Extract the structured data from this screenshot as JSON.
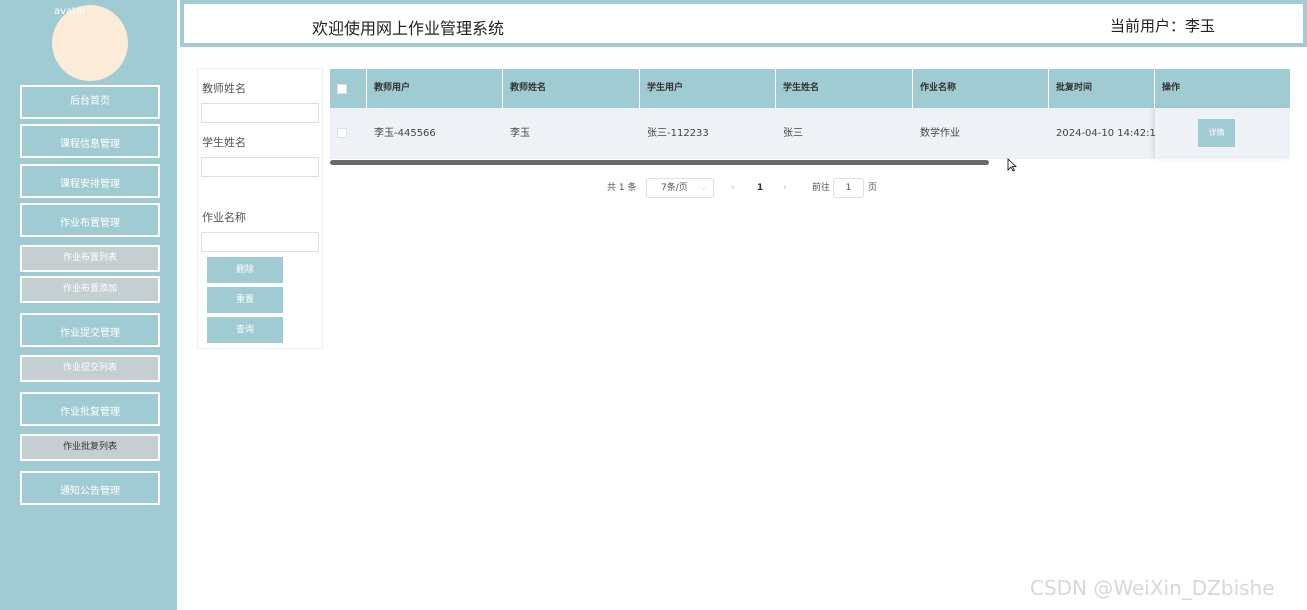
{
  "sidebar": {
    "avatar_alt": "avatar",
    "items": [
      {
        "label": "后台首页",
        "kind": "main"
      },
      {
        "label": "课程信息管理",
        "kind": "main"
      },
      {
        "label": "课程安排管理",
        "kind": "main"
      },
      {
        "label": "作业布置管理",
        "kind": "main"
      },
      {
        "label": "作业布置列表",
        "kind": "sub"
      },
      {
        "label": "作业布置添加",
        "kind": "sub"
      },
      {
        "label": "作业提交管理",
        "kind": "main"
      },
      {
        "label": "作业提交列表",
        "kind": "sub"
      },
      {
        "label": "作业批复管理",
        "kind": "main"
      },
      {
        "label": "作业批复列表",
        "kind": "sub-active"
      },
      {
        "label": "通知公告管理",
        "kind": "main"
      }
    ]
  },
  "header": {
    "title": "欢迎使用网上作业管理系统",
    "user": "当前用户：李玉"
  },
  "search": {
    "teacher_name_label": "教师姓名",
    "student_name_label": "学生姓名",
    "homework_name_label": "作业名称",
    "delete_label": "删除",
    "reset_label": "重置",
    "query_label": "查询"
  },
  "table": {
    "columns": [
      "教师用户",
      "教师姓名",
      "学生用户",
      "学生姓名",
      "作业名称",
      "批复时间",
      "操作"
    ],
    "rows": [
      {
        "teacher_user": "李玉-445566",
        "teacher_name": "李玉",
        "student_user": "张三-112233",
        "student_name": "张三",
        "homework_name": "数学作业",
        "reply_time": "2024-04-10 14:42:1",
        "action": "详情"
      }
    ]
  },
  "pagination": {
    "total": "共 1 条",
    "page_size": "7条/页",
    "current_page": "1",
    "goto_label": "前往",
    "goto_value": "1",
    "page_unit": "页"
  },
  "watermark": "CSDN @WeiXin_DZbishe",
  "colors": {
    "accent": "#a1cbd3",
    "sub_nav": "#c5cfd1",
    "avatar": "#fcebd8"
  }
}
